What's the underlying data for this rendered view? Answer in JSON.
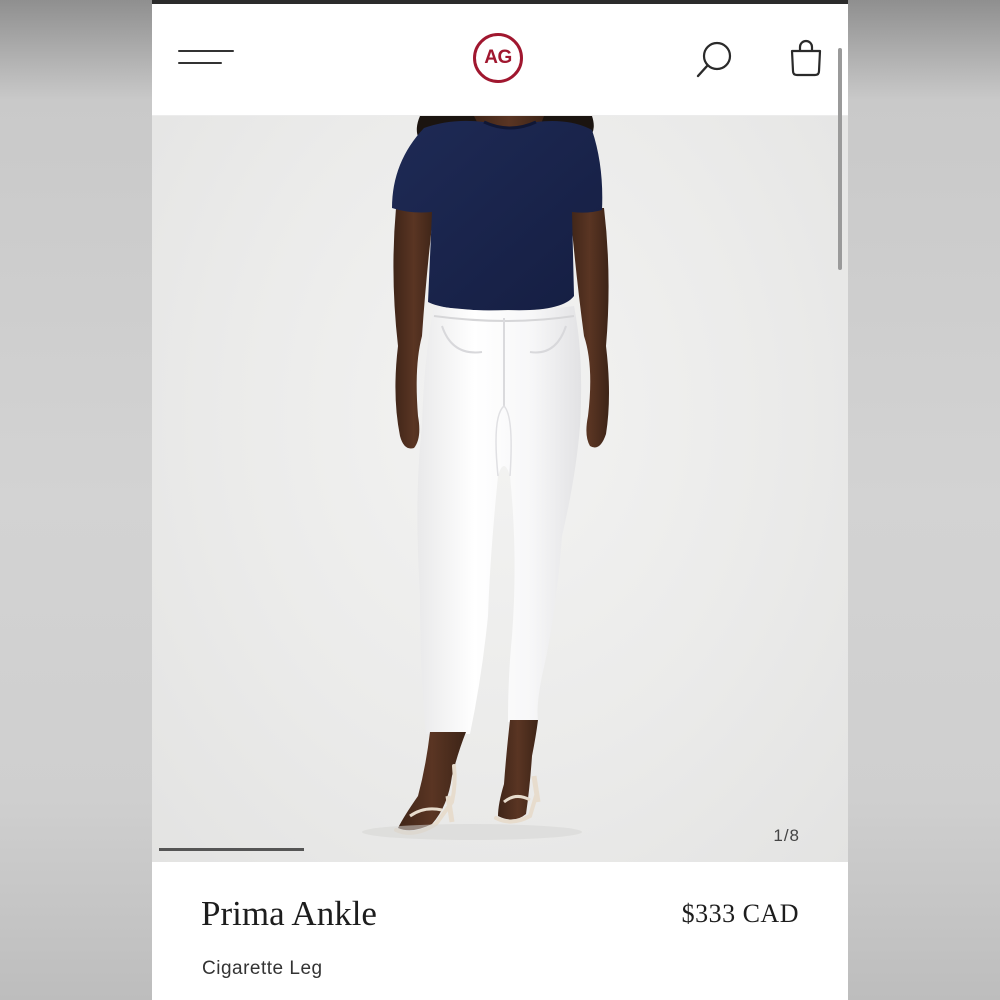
{
  "header": {
    "logo_text": "AG",
    "brand_color": "#a0172f",
    "menu_icon": "hamburger-icon",
    "search_icon": "search-icon",
    "cart_icon": "shopping-bag-icon"
  },
  "gallery": {
    "counter": "1/8",
    "current_image": 1,
    "total_images": 8,
    "progress_fraction": 0.125
  },
  "product": {
    "name": "Prima Ankle",
    "price": "$333 CAD",
    "fit": "Cigarette Leg"
  }
}
